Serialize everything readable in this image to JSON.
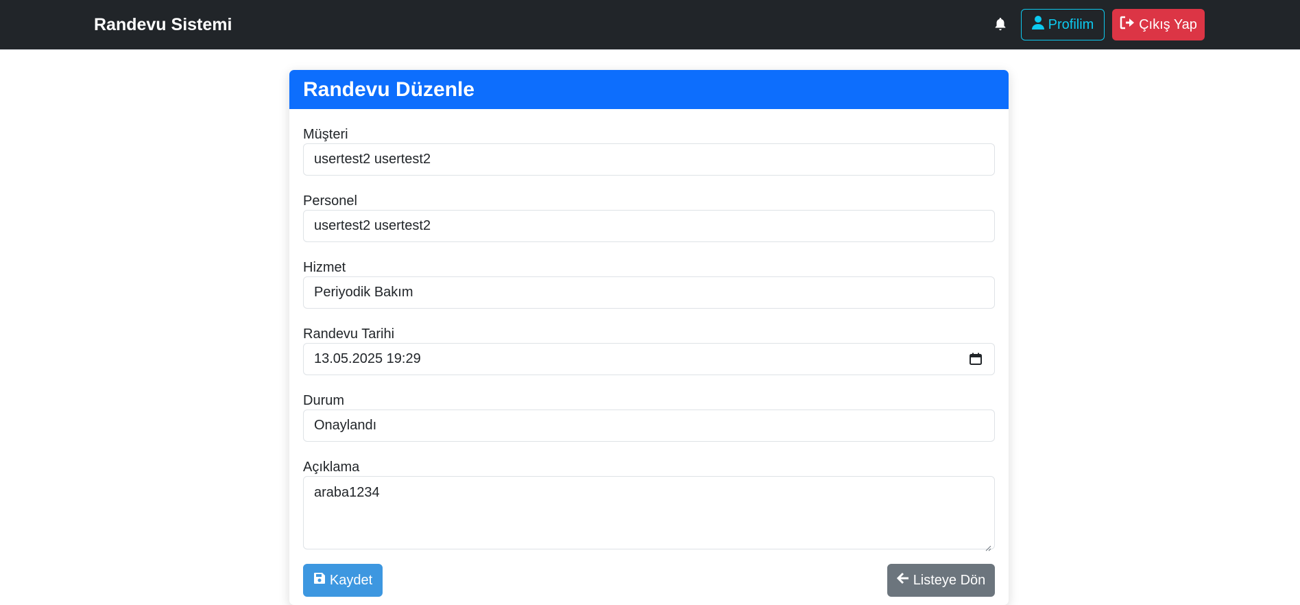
{
  "navbar": {
    "brand": "Randevu Sistemi",
    "profile_label": "Profilim",
    "logout_label": "Çıkış Yap"
  },
  "card": {
    "title": "Randevu Düzenle"
  },
  "form": {
    "customer": {
      "label": "Müşteri",
      "value": "usertest2 usertest2"
    },
    "staff": {
      "label": "Personel",
      "value": "usertest2 usertest2"
    },
    "service": {
      "label": "Hizmet",
      "value": "Periyodik Bakım"
    },
    "date": {
      "label": "Randevu Tarihi",
      "value": "13.05.2025 19:29"
    },
    "status": {
      "label": "Durum",
      "value": "Onaylandı"
    },
    "description": {
      "label": "Açıklama",
      "value": "araba1234"
    }
  },
  "buttons": {
    "save_label": "Kaydet",
    "back_label": "Listeye Dön"
  },
  "colors": {
    "navbar": "#212529",
    "primary": "#0d6efd",
    "info": "#0dcaf0",
    "danger": "#dc3545",
    "secondary": "#6c757d"
  },
  "icons": [
    "bell-icon",
    "user-icon",
    "sign-out-icon",
    "calendar-icon",
    "save-icon",
    "arrow-left-icon"
  ]
}
